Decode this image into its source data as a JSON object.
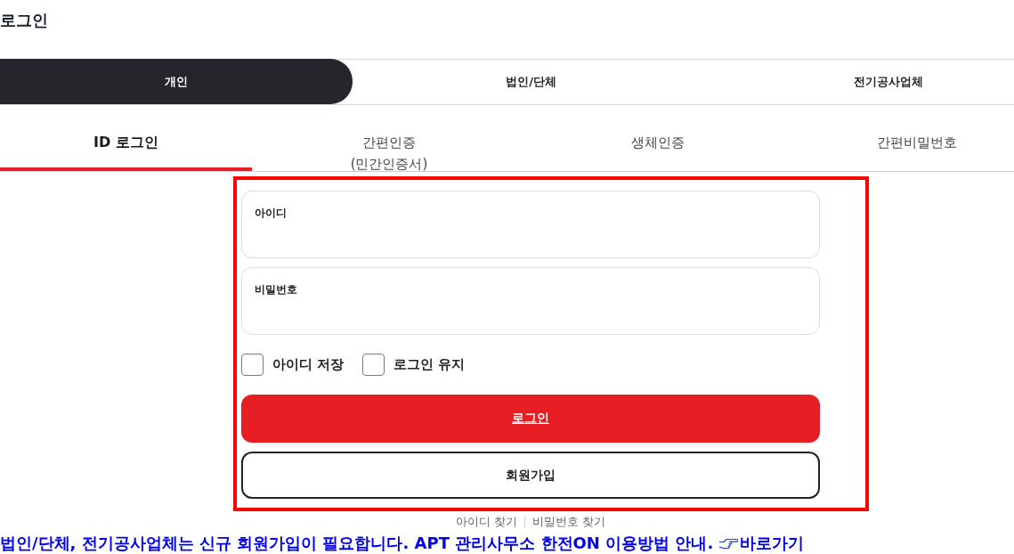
{
  "page_title": "로그인",
  "member_tabs": [
    {
      "label": "개인",
      "selected": true
    },
    {
      "label": "법인/단체",
      "selected": false
    },
    {
      "label": "전기공사업체",
      "selected": false
    }
  ],
  "login_tabs": [
    {
      "lines": [
        "ID 로그인"
      ],
      "selected": true
    },
    {
      "lines": [
        "간편인증",
        "(민간인증서)"
      ],
      "selected": false
    },
    {
      "lines": [
        "생체인증"
      ],
      "selected": false
    },
    {
      "lines": [
        "간편비밀번호"
      ],
      "selected": false
    }
  ],
  "fields": [
    {
      "label": "아이디"
    },
    {
      "label": "비밀번호"
    }
  ],
  "options": [
    {
      "label": "아이디 저장",
      "checked": false
    },
    {
      "label": "로그인 유지",
      "checked": false
    }
  ],
  "buttons": [
    {
      "label": "로그인",
      "kind": "primary"
    },
    {
      "label": "회원가입",
      "kind": "outline"
    }
  ],
  "find_links": [
    "아이디 찾기",
    "비밀번호 찾기"
  ],
  "notice": {
    "text": "법인/단체, 전기공사업체는 신규 회원가입이 필요합니다. APT 관리사무소 한전ON 이용방법 안내.",
    "link": "바로가기"
  }
}
